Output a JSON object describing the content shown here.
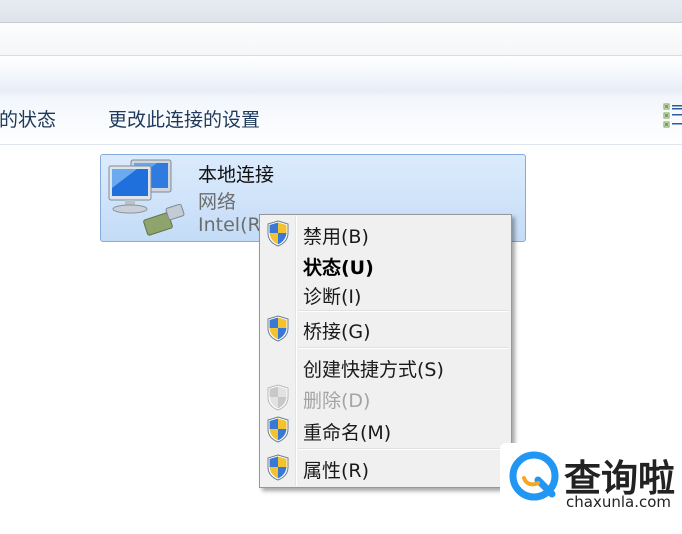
{
  "command_bar": {
    "status_link": "的状态",
    "change_settings_link": "更改此连接的设置"
  },
  "connection": {
    "name": "本地连接",
    "type": "网络",
    "device": "Intel(R"
  },
  "context_menu": {
    "items": [
      {
        "label": "禁用(B)",
        "icon": "uac-shield-icon",
        "style": "normal"
      },
      {
        "label": "状态(U)",
        "icon": null,
        "style": "bold"
      },
      {
        "label": "诊断(I)",
        "icon": null,
        "style": "normal"
      },
      {
        "label": "桥接(G)",
        "icon": "uac-shield-icon",
        "style": "normal"
      },
      {
        "label": "创建快捷方式(S)",
        "icon": null,
        "style": "normal"
      },
      {
        "label": "删除(D)",
        "icon": "uac-shield-icon",
        "style": "disabled"
      },
      {
        "label": "重命名(M)",
        "icon": "uac-shield-icon",
        "style": "normal"
      },
      {
        "label": "属性(R)",
        "icon": "uac-shield-icon",
        "style": "normal"
      }
    ]
  },
  "watermark": {
    "title": "查询啦",
    "url": "chaxunla.com"
  },
  "colors": {
    "tile_selection": "#c4dcf7",
    "menu_background": "#f0f0f0",
    "watermark_blue": "#2196f3",
    "watermark_orange": "#f5a623"
  }
}
